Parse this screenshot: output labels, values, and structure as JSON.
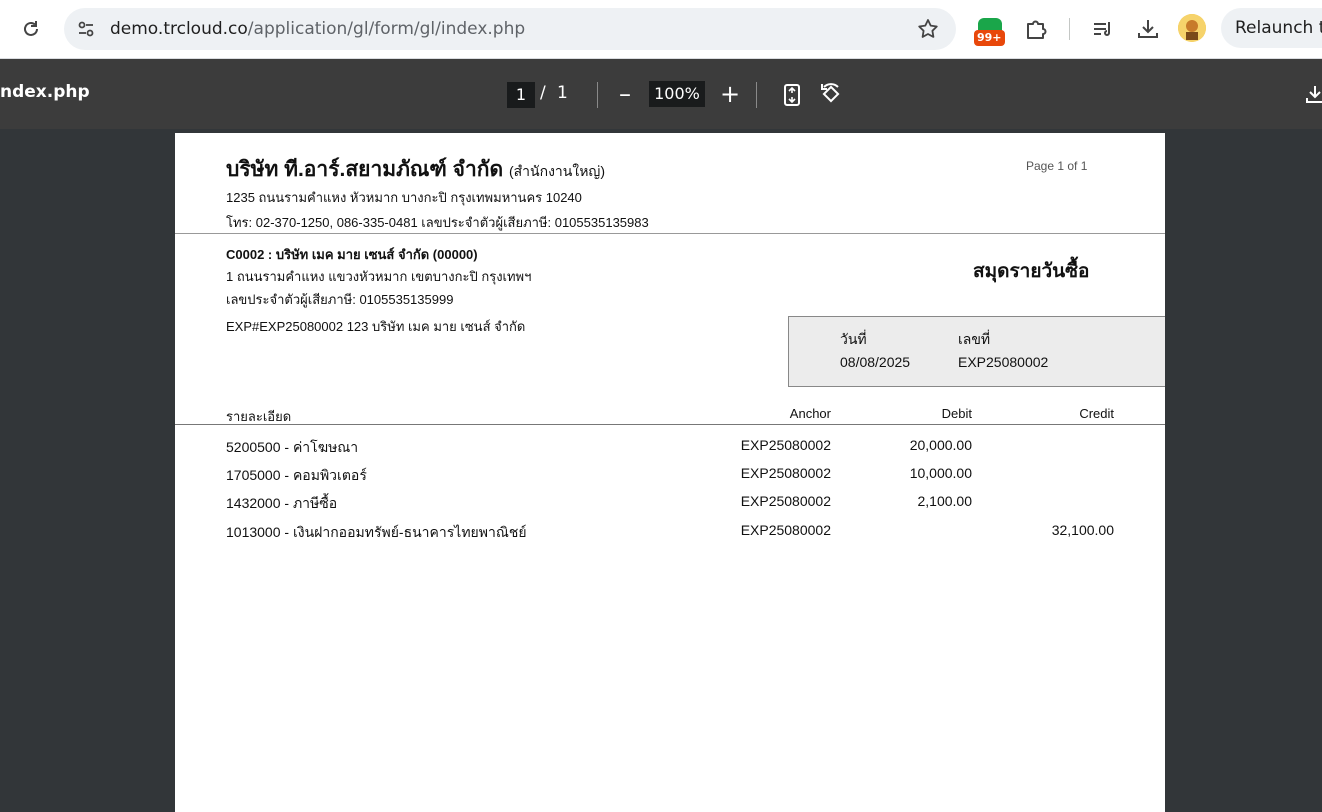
{
  "browser": {
    "url_domain": "demo.trcloud.co",
    "url_path": "/application/gl/form/gl/index.php",
    "extension_badge": "99+",
    "relaunch_label": "Relaunch t"
  },
  "pdf_toolbar": {
    "title": "ndex.php",
    "current_page": "1",
    "page_separator": "/",
    "total_pages": "1",
    "zoom_out": "–",
    "zoom": "100%",
    "zoom_in": "+"
  },
  "document": {
    "company_name": "บริษัท ที.อาร์.สยามภัณฑ์ จำกัด",
    "branch": "(สำนักงานใหญ่)",
    "page_label": "Page 1 of 1",
    "address": "1235 ถนนรามคำแหง หัวหมาก บางกะปิ กรุงเทพมหานคร 10240",
    "contact": "โทร: 02-370-1250, 086-335-0481 เลขประจำตัวผู้เสียภาษี: 0105535135983",
    "customer_code": "C0002 : บริษัท เมค มาย เซนส์ จำกัด (00000)",
    "customer_address": "1 ถนนรามคำแหง แขวงหัวหมาก เขตบางกะปิ กรุงเทพฯ",
    "customer_tax": "เลขประจำตัวผู้เสียภาษี: 0105535135999",
    "reference": "EXP#EXP25080002 123 บริษัท เมค มาย เซนส์ จำกัด",
    "doc_type": "สมุดรายวันซื้อ",
    "date_label": "วันที่",
    "number_label": "เลขที่",
    "date_value": "08/08/2025",
    "number_value": "EXP25080002",
    "columns": {
      "detail": "รายละเอียด",
      "anchor": "Anchor",
      "debit": "Debit",
      "credit": "Credit"
    },
    "rows": [
      {
        "desc": "5200500 - ค่าโฆษณา",
        "anchor": "EXP25080002",
        "debit": "20,000.00",
        "credit": ""
      },
      {
        "desc": "1705000 - คอมพิวเตอร์",
        "anchor": "EXP25080002",
        "debit": "10,000.00",
        "credit": ""
      },
      {
        "desc": "1432000 - ภาษีซื้อ",
        "anchor": "EXP25080002",
        "debit": "2,100.00",
        "credit": ""
      },
      {
        "desc": "1013000 - เงินฝากออมทรัพย์-ธนาคารไทยพาณิชย์",
        "anchor": "EXP25080002",
        "debit": "",
        "credit": "32,100.00"
      }
    ]
  }
}
